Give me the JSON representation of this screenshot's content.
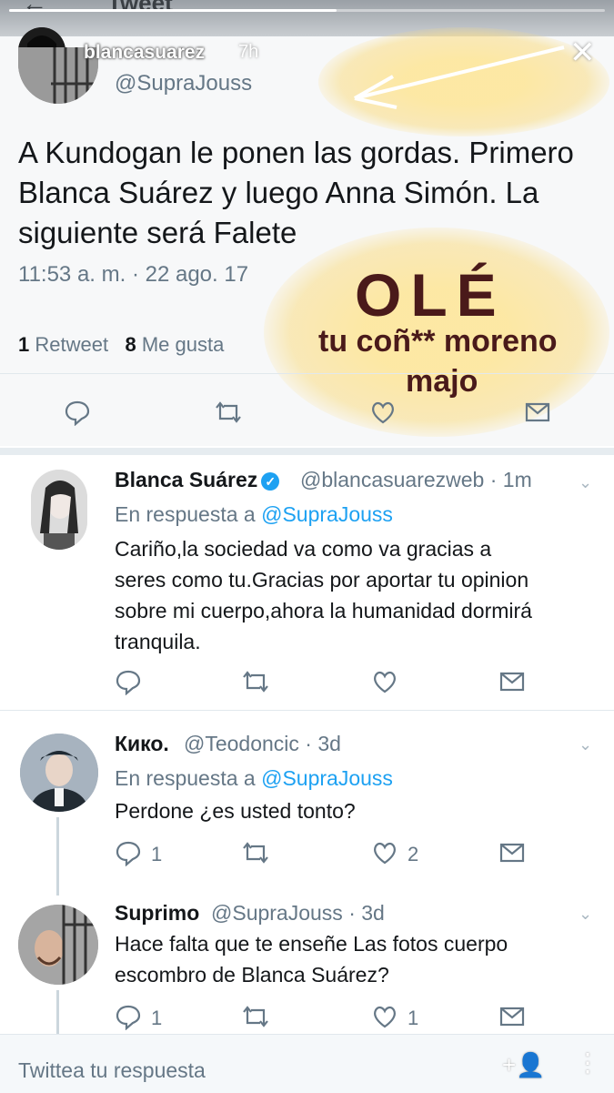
{
  "story": {
    "progress": 0.55,
    "username": "blancasuarez",
    "time": "7h",
    "close_label": "✕",
    "header_title": "Tweet",
    "back_label": "←"
  },
  "main_tweet": {
    "handle": "@SupraJouss",
    "text": "A Kundogan le ponen las gordas. Primero Blanca Suárez y luego Anna Simón. La siguiente será Falete",
    "timestamp": "11:53 a. m. · 22 ago. 17",
    "retweets": "1",
    "retweets_label": "Retweet",
    "likes": "8",
    "likes_label": "Me gusta"
  },
  "overlay": {
    "ole": "OLÉ",
    "line1": "tu coñ** moreno",
    "line2": "majo"
  },
  "replies": [
    {
      "name": "Blanca Suárez",
      "handle": "@blancasuarezweb · 1m",
      "in_reply_prefix": "En respuesta a",
      "in_reply_to": "@SupraJouss",
      "text_lines": [
        "Cariño,la sociedad va como va gracias a",
        "seres como tu.Gracias por aportar tu opinion",
        "sobre mi cuerpo,ahora la humanidad dormirá",
        "tranquila."
      ],
      "reply_count": "",
      "like_count": ""
    },
    {
      "name": "Кико.",
      "handle": "@Teodoncic · 3d",
      "in_reply_prefix": "En respuesta a",
      "in_reply_to": "@SupraJouss",
      "text_lines": [
        "Perdone ¿es usted tonto?"
      ],
      "reply_count": "1",
      "like_count": "2"
    },
    {
      "name": "Suprimo",
      "handle": "@SupraJouss · 3d",
      "text_lines": [
        "Hace falta que te enseñe Las fotos cuerpo",
        "escombro de Blanca Suárez?"
      ],
      "reply_count": "1",
      "like_count": "1"
    }
  ],
  "composer": {
    "placeholder": "Twittea tu respuesta",
    "add_user": "+👤",
    "more": "⋮"
  },
  "colors": {
    "link": "#1da1f2",
    "secondary_text": "#657786",
    "overlay_text": "#4a1a1a",
    "highlight": "#fde7a0"
  }
}
